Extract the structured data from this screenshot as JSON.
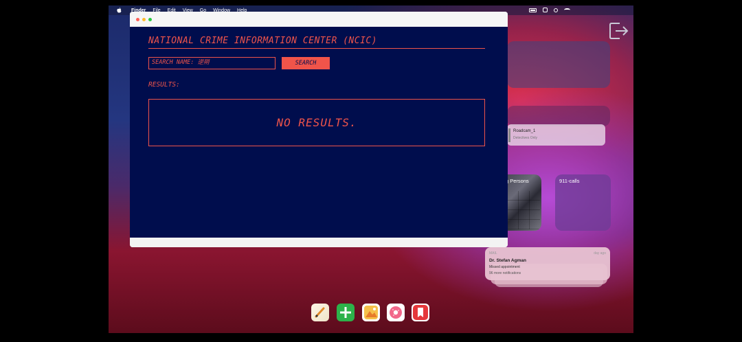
{
  "menubar": {
    "items": [
      "Finder",
      "File",
      "Edit",
      "View",
      "Go",
      "Window",
      "Help"
    ]
  },
  "widgets": {
    "roadcam": {
      "title": "Roadcam_1",
      "subtitle": "Detectives Only"
    },
    "missing_persons": {
      "label": "g Persons"
    },
    "calls": {
      "label": "911-calls"
    },
    "notification": {
      "app": "MAIL",
      "time": "day ago",
      "from": "Dr. Stefan Agman",
      "message": "Missed appointment",
      "more": "96 more notifications"
    }
  },
  "app": {
    "title": "NATIONAL CRIME INFORMATION CENTER (NCIC)",
    "search": {
      "label": "SEARCH NAME:",
      "value": "逆朔"
    },
    "search_button": "SEARCH",
    "results_label": "RESULTS:",
    "no_results": "NO RESULTS."
  },
  "colors": {
    "accent": "#f0544a",
    "app_background": "#000d4d"
  },
  "dock": [
    "pencil-icon",
    "plus-icon",
    "photos-icon",
    "donut-icon",
    "bookmark-icon"
  ]
}
